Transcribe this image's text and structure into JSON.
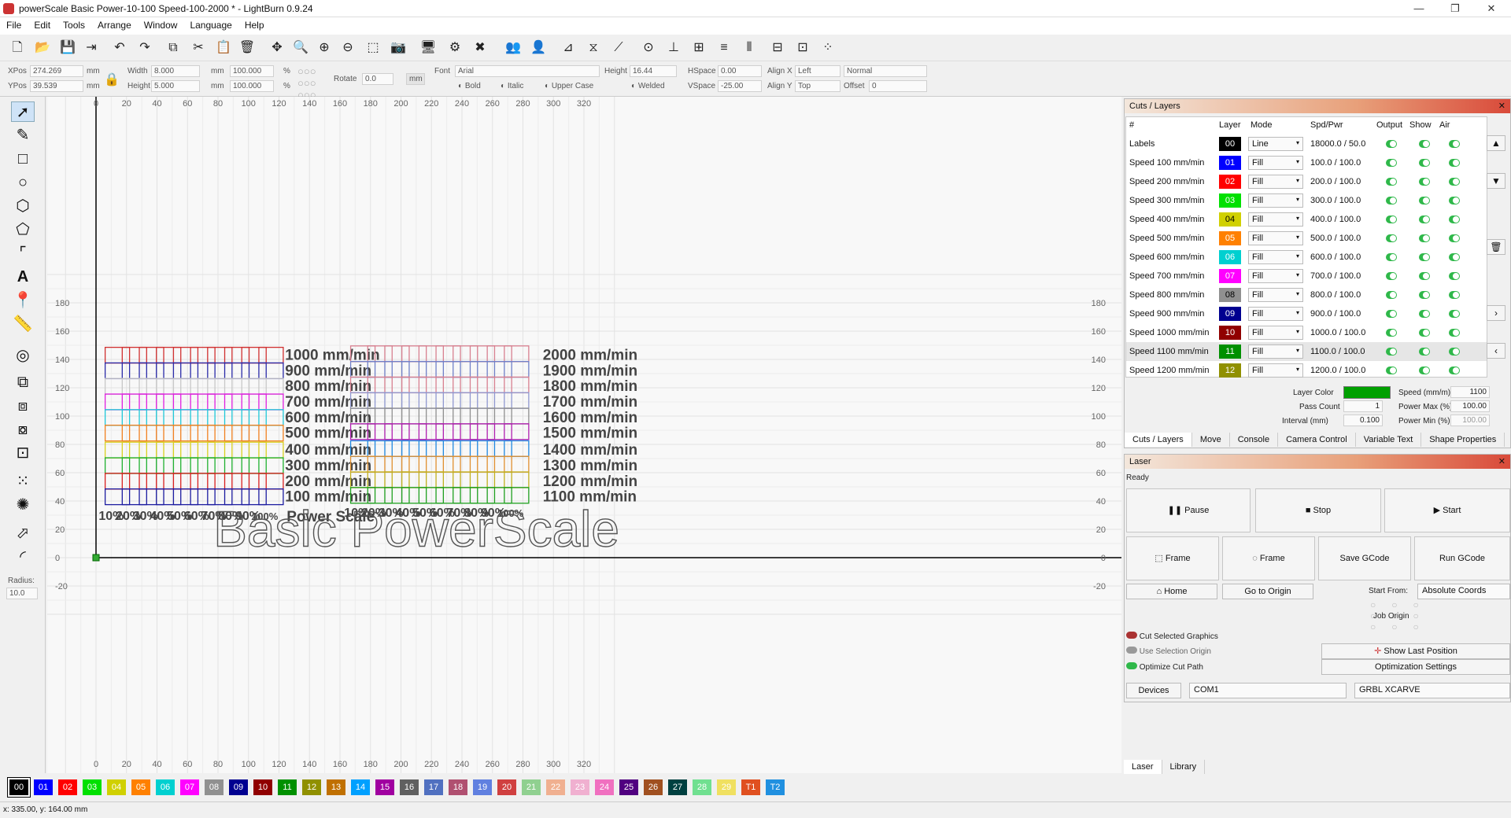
{
  "window": {
    "title": "powerScale Basic Power-10-100 Speed-100-2000 * - LightBurn 0.9.24",
    "min": "—",
    "max": "❐",
    "close": "✕"
  },
  "menu": [
    "File",
    "Edit",
    "Tools",
    "Arrange",
    "Window",
    "Language",
    "Help"
  ],
  "props": {
    "xpos_label": "XPos",
    "xpos": "274.269",
    "ypos_label": "YPos",
    "ypos": "39.539",
    "unit": "mm",
    "width_label": "Width",
    "width": "8.000",
    "height_label": "Height",
    "height": "5.000",
    "wpct": "100.000",
    "hpct": "100.000",
    "pct": "%",
    "rotate_label": "Rotate",
    "rotate": "0.0",
    "unit_btn": "mm",
    "font_label": "Font",
    "font": "Arial",
    "fheight_label": "Height",
    "fheight": "16.44",
    "hspace_label": "HSpace",
    "hspace": "0.00",
    "vspace_label": "VSpace",
    "vspace": "-25.00",
    "alignx_label": "Align X",
    "alignx": "Left",
    "aligny_label": "Align Y",
    "aligny": "Top",
    "style": "Normal",
    "offset_label": "Offset",
    "offset": "0",
    "bold": "Bold",
    "italic": "Italic",
    "upper": "Upper Case",
    "welded": "Welded"
  },
  "tools": {
    "radius_label": "Radius:",
    "radius": "10.0"
  },
  "canvas": {
    "xticks": [
      "0",
      "20",
      "40",
      "60",
      "80",
      "100",
      "120",
      "140",
      "160",
      "180",
      "200",
      "220",
      "240",
      "260",
      "280",
      "300",
      "320"
    ],
    "yticks": [
      "180",
      "160",
      "140",
      "120",
      "100",
      "80",
      "60",
      "40",
      "20",
      "0",
      "-20"
    ],
    "speeds_left": [
      "1000 mm/min",
      "900 mm/min",
      "800 mm/min",
      "700 mm/min",
      "600 mm/min",
      "500 mm/min",
      "400 mm/min",
      "300 mm/min",
      "200 mm/min",
      "100 mm/min"
    ],
    "speeds_right": [
      "2000 mm/min",
      "1900 mm/min",
      "1800 mm/min",
      "1700 mm/min",
      "1600 mm/min",
      "1500 mm/min",
      "1400 mm/min",
      "1300 mm/min",
      "1200 mm/min",
      "1100 mm/min"
    ],
    "powers": [
      "10%",
      "20%",
      "30%",
      "40%",
      "50%",
      "60%",
      "70%",
      "80%",
      "90%",
      "100%"
    ],
    "power_scale": "Power Scale",
    "big_title": "Basic PowerScale",
    "left_colors": [
      "#d03030",
      "#2a2aa8",
      "#c8c8c8",
      "#e020e0",
      "#20c8d8",
      "#f08020",
      "#d8d020",
      "#20b030",
      "#d82020",
      "#1c1ca0"
    ],
    "right_colors": [
      "#d88090",
      "#7080c8",
      "#d88090",
      "#9098d0",
      "#909090",
      "#b020b0",
      "#2088e0",
      "#e09030",
      "#c0b020",
      "#20a020"
    ]
  },
  "palette": [
    {
      "t": "00",
      "c": "#000000"
    },
    {
      "t": "01",
      "c": "#0000ff"
    },
    {
      "t": "02",
      "c": "#ff0000"
    },
    {
      "t": "03",
      "c": "#00e000"
    },
    {
      "t": "04",
      "c": "#d0d000"
    },
    {
      "t": "05",
      "c": "#ff8000"
    },
    {
      "t": "06",
      "c": "#00d0d0"
    },
    {
      "t": "07",
      "c": "#ff00ff"
    },
    {
      "t": "08",
      "c": "#909090"
    },
    {
      "t": "09",
      "c": "#000090"
    },
    {
      "t": "10",
      "c": "#900000"
    },
    {
      "t": "11",
      "c": "#009000"
    },
    {
      "t": "12",
      "c": "#909000"
    },
    {
      "t": "13",
      "c": "#c07000"
    },
    {
      "t": "14",
      "c": "#00a0ff"
    },
    {
      "t": "15",
      "c": "#a000a0"
    },
    {
      "t": "16",
      "c": "#606060"
    },
    {
      "t": "17",
      "c": "#5070c0"
    },
    {
      "t": "18",
      "c": "#b05070"
    },
    {
      "t": "19",
      "c": "#6080e0"
    },
    {
      "t": "20",
      "c": "#d04040"
    },
    {
      "t": "21",
      "c": "#90d090"
    },
    {
      "t": "22",
      "c": "#f0b090"
    },
    {
      "t": "23",
      "c": "#f0b0d0"
    },
    {
      "t": "24",
      "c": "#f070c0"
    },
    {
      "t": "25",
      "c": "#500080"
    },
    {
      "t": "26",
      "c": "#a05020"
    },
    {
      "t": "27",
      "c": "#004040"
    },
    {
      "t": "28",
      "c": "#70e090"
    },
    {
      "t": "29",
      "c": "#f0e060"
    },
    {
      "t": "T1",
      "c": "#e05020"
    },
    {
      "t": "T2",
      "c": "#2090e0"
    }
  ],
  "status": "x: 335.00, y: 164.00 mm",
  "cuts": {
    "title": "Cuts / Layers",
    "headers": [
      "#",
      "Layer",
      "Mode",
      "Spd/Pwr",
      "Output",
      "Show",
      "Air"
    ],
    "rows": [
      {
        "name": "Labels",
        "layer": "00",
        "color": "#000000",
        "mode": "Line",
        "sp": "18000.0 / 50.0"
      },
      {
        "name": "Speed 100 mm/min",
        "layer": "01",
        "color": "#0000ff",
        "mode": "Fill",
        "sp": "100.0 / 100.0"
      },
      {
        "name": "Speed 200 mm/min",
        "layer": "02",
        "color": "#ff0000",
        "mode": "Fill",
        "sp": "200.0 / 100.0"
      },
      {
        "name": "Speed 300 mm/min",
        "layer": "03",
        "color": "#00e000",
        "mode": "Fill",
        "sp": "300.0 / 100.0"
      },
      {
        "name": "Speed 400 mm/min",
        "layer": "04",
        "color": "#d0d000",
        "mode": "Fill",
        "sp": "400.0 / 100.0"
      },
      {
        "name": "Speed 500 mm/min",
        "layer": "05",
        "color": "#ff8000",
        "mode": "Fill",
        "sp": "500.0 / 100.0"
      },
      {
        "name": "Speed 600 mm/min",
        "layer": "06",
        "color": "#00d0d0",
        "mode": "Fill",
        "sp": "600.0 / 100.0"
      },
      {
        "name": "Speed 700 mm/min",
        "layer": "07",
        "color": "#ff00ff",
        "mode": "Fill",
        "sp": "700.0 / 100.0"
      },
      {
        "name": "Speed 800 mm/min",
        "layer": "08",
        "color": "#909090",
        "mode": "Fill",
        "sp": "800.0 / 100.0"
      },
      {
        "name": "Speed 900 mm/min",
        "layer": "09",
        "color": "#000090",
        "mode": "Fill",
        "sp": "900.0 / 100.0"
      },
      {
        "name": "Speed 1000 mm/min",
        "layer": "10",
        "color": "#900000",
        "mode": "Fill",
        "sp": "1000.0 / 100.0"
      },
      {
        "name": "Speed 1100 mm/min",
        "layer": "11",
        "color": "#009000",
        "mode": "Fill",
        "sp": "1100.0 / 100.0"
      },
      {
        "name": "Speed 1200 mm/min",
        "layer": "12",
        "color": "#909000",
        "mode": "Fill",
        "sp": "1200.0 / 100.0"
      }
    ],
    "layer_color_label": "Layer Color",
    "layer_color": "#00a000",
    "speed_label": "Speed (mm/m)",
    "speed": "1100",
    "pass_label": "Pass Count",
    "pass": "1",
    "pmax_label": "Power Max (%)",
    "pmax": "100.00",
    "interval_label": "Interval (mm)",
    "interval": "0.100",
    "pmin_label": "Power Min (%)",
    "pmin": "100.00",
    "tabs": [
      "Cuts / Layers",
      "Move",
      "Console",
      "Camera Control",
      "Variable Text",
      "Shape Properties"
    ]
  },
  "laser": {
    "title": "Laser",
    "status": "Ready",
    "pause": "Pause",
    "stop": "Stop",
    "start": "Start",
    "frame1": "Frame",
    "frame2": "Frame",
    "save": "Save GCode",
    "run": "Run GCode",
    "home": "Home",
    "origin": "Go to Origin",
    "start_from_label": "Start From:",
    "start_from": "Absolute Coords",
    "job_origin": "Job Origin",
    "cut_sel": "Cut Selected Graphics",
    "use_sel": "Use Selection Origin",
    "optimize": "Optimize Cut Path",
    "show_last": "Show Last Position",
    "opt_settings": "Optimization Settings",
    "devices": "Devices",
    "port": "COM1",
    "device": "GRBL XCARVE",
    "tabs": [
      "Laser",
      "Library"
    ]
  }
}
